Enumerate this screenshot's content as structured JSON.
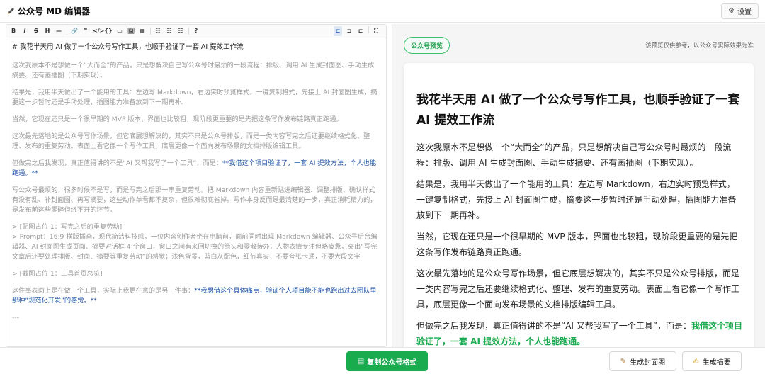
{
  "header": {
    "title": "公众号 MD 编辑器",
    "settings_label": "设置"
  },
  "toolbar": {
    "buttons": [
      "B",
      "I",
      "S",
      "H",
      "—",
      "☰",
      "🔗",
      "❞",
      "</>",
      "{}",
      "▭",
      "🖼",
      "▦",
      "☷",
      "☷",
      "☷",
      "?"
    ],
    "right": [
      "⊏",
      "⊐",
      "⊏",
      "⛶"
    ]
  },
  "editor": {
    "h1": "# 我花半天用 AI 做了一个公众号写作工具，也顺手验证了一套 AI 提效工作流",
    "p1": "这次我原本不是想做一个“大而全”的产品，只是想解决自己写公众号时最烦的一段流程：排版、调用 AI 生成封面图、手动生成摘要、还有画插图（下期实现）。",
    "p2": "结果是，我用半天做出了一个能用的工具：左边写 Markdown，右边实时预览样式，一键复制格式，先接上 AI 封面图生成，摘要这一步暂时还是手动处理，插图能力准备放到下一期再补。",
    "p3": "当然，它现在还只是一个很早期的 MVP 版本，界面也比较粗，现阶段更重要的是先把这条写作发布链路真正跑通。",
    "p4": "这次最先落地的是公众号写作场景，但它底层想解决的，其实不只是公众号排版，而是一类内容写完之后还要继续格式化、整理、发布的重复劳动。表面上看它像一个写作工具，底层更像一个面向发布场景的文档排版编辑工具。",
    "p5_pre": "但做完之后我发现，真正值得讲的不是“AI 又帮我写了一个工具”，而是：",
    "p5_hl": "**我借这个项目验证了，一套 AI 提效方法，个人也能跑通。**",
    "p6": "写公众号最烦的，很多时候不是写，而是写完之后那一串重复劳动。把 Markdown 内容重新贴进编辑器、调整排版、确认样式有没有乱、补封面图、再写摘要，这些动作单看都不复杂，但很难彻底省掉。写作本身反而是最清楚的一步，真正消耗精力的，是发布前这些零碎但绕不开的环节。",
    "p7_l1": "> [配图占位 1：写完之后的重复劳动]",
    "p7_l2": "> Prompt：16:9 横版插画，现代简洁科技感，一位内容创作者坐在电脑前，面前同时出现 Markdown 编辑器、公众号后台编辑器、AI 封面图生成页面、摘要对话框 4 个窗口，窗口之间有来回切换的箭头和零散待办，人物表情专注但略疲惫，突出“写完文章后还要处理排版、封面、摘要等重复劳动”的感觉；浅色背景，蓝白灰配色，细节真实，不要夸张卡通，不要大段文字",
    "p8": "> [截图占位 1：工具首页总览]",
    "p9_pre": "这件事表面上是在做一个工具，实际上我更在意的是另一件事：",
    "p9_hl": "**我想借这个具体痛点，验证个人项目能不能也跑出过去团队里那种“规范化开发”的感觉。**",
    "rule": "---"
  },
  "preview": {
    "badge": "公众号预览",
    "note": "该预览仅供参考，以公众号实际效果为准",
    "title": "我花半天用 AI 做了一个公众号写作工具，也顺手验证了一套 AI 提效工作流",
    "p1": "这次我原本不是想做一个“大而全”的产品，只是想解决自己写公众号时最烦的一段流程：排版、调用 AI 生成封面图、手动生成摘要、还有画插图（下期实现）。",
    "p2": "结果是，我用半天做出了一个能用的工具：左边写 Markdown，右边实时预览样式，一键复制格式，先接上 AI 封面图生成，摘要这一步暂时还是手动处理，插图能力准备放到下一期再补。",
    "p3": "当然，它现在还只是一个很早期的 MVP 版本，界面也比较粗，现阶段更重要的是先把这条写作发布链路真正跑通。",
    "p4": "这次最先落地的是公众号写作场景，但它底层想解决的，其实不只是公众号排版，而是一类内容写完之后还要继续格式化、整理、发布的重复劳动。表面上看它像一个写作工具，底层更像一个面向发布场景的文档排版编辑工具。",
    "p5_pre": "但做完之后我发现，真正值得讲的不是“AI 又帮我写了一个工具”，而是：",
    "p5_hl": "我借这个项目验证了，一套 AI 提效方法，个人也能跑通。"
  },
  "bottom": {
    "copy_label": "复制公众号格式",
    "cover_label": "生成封面图",
    "summary_label": "生成摘要"
  },
  "colors": {
    "accent_green": "#1aab4f",
    "link_blue": "#1f52a6"
  }
}
